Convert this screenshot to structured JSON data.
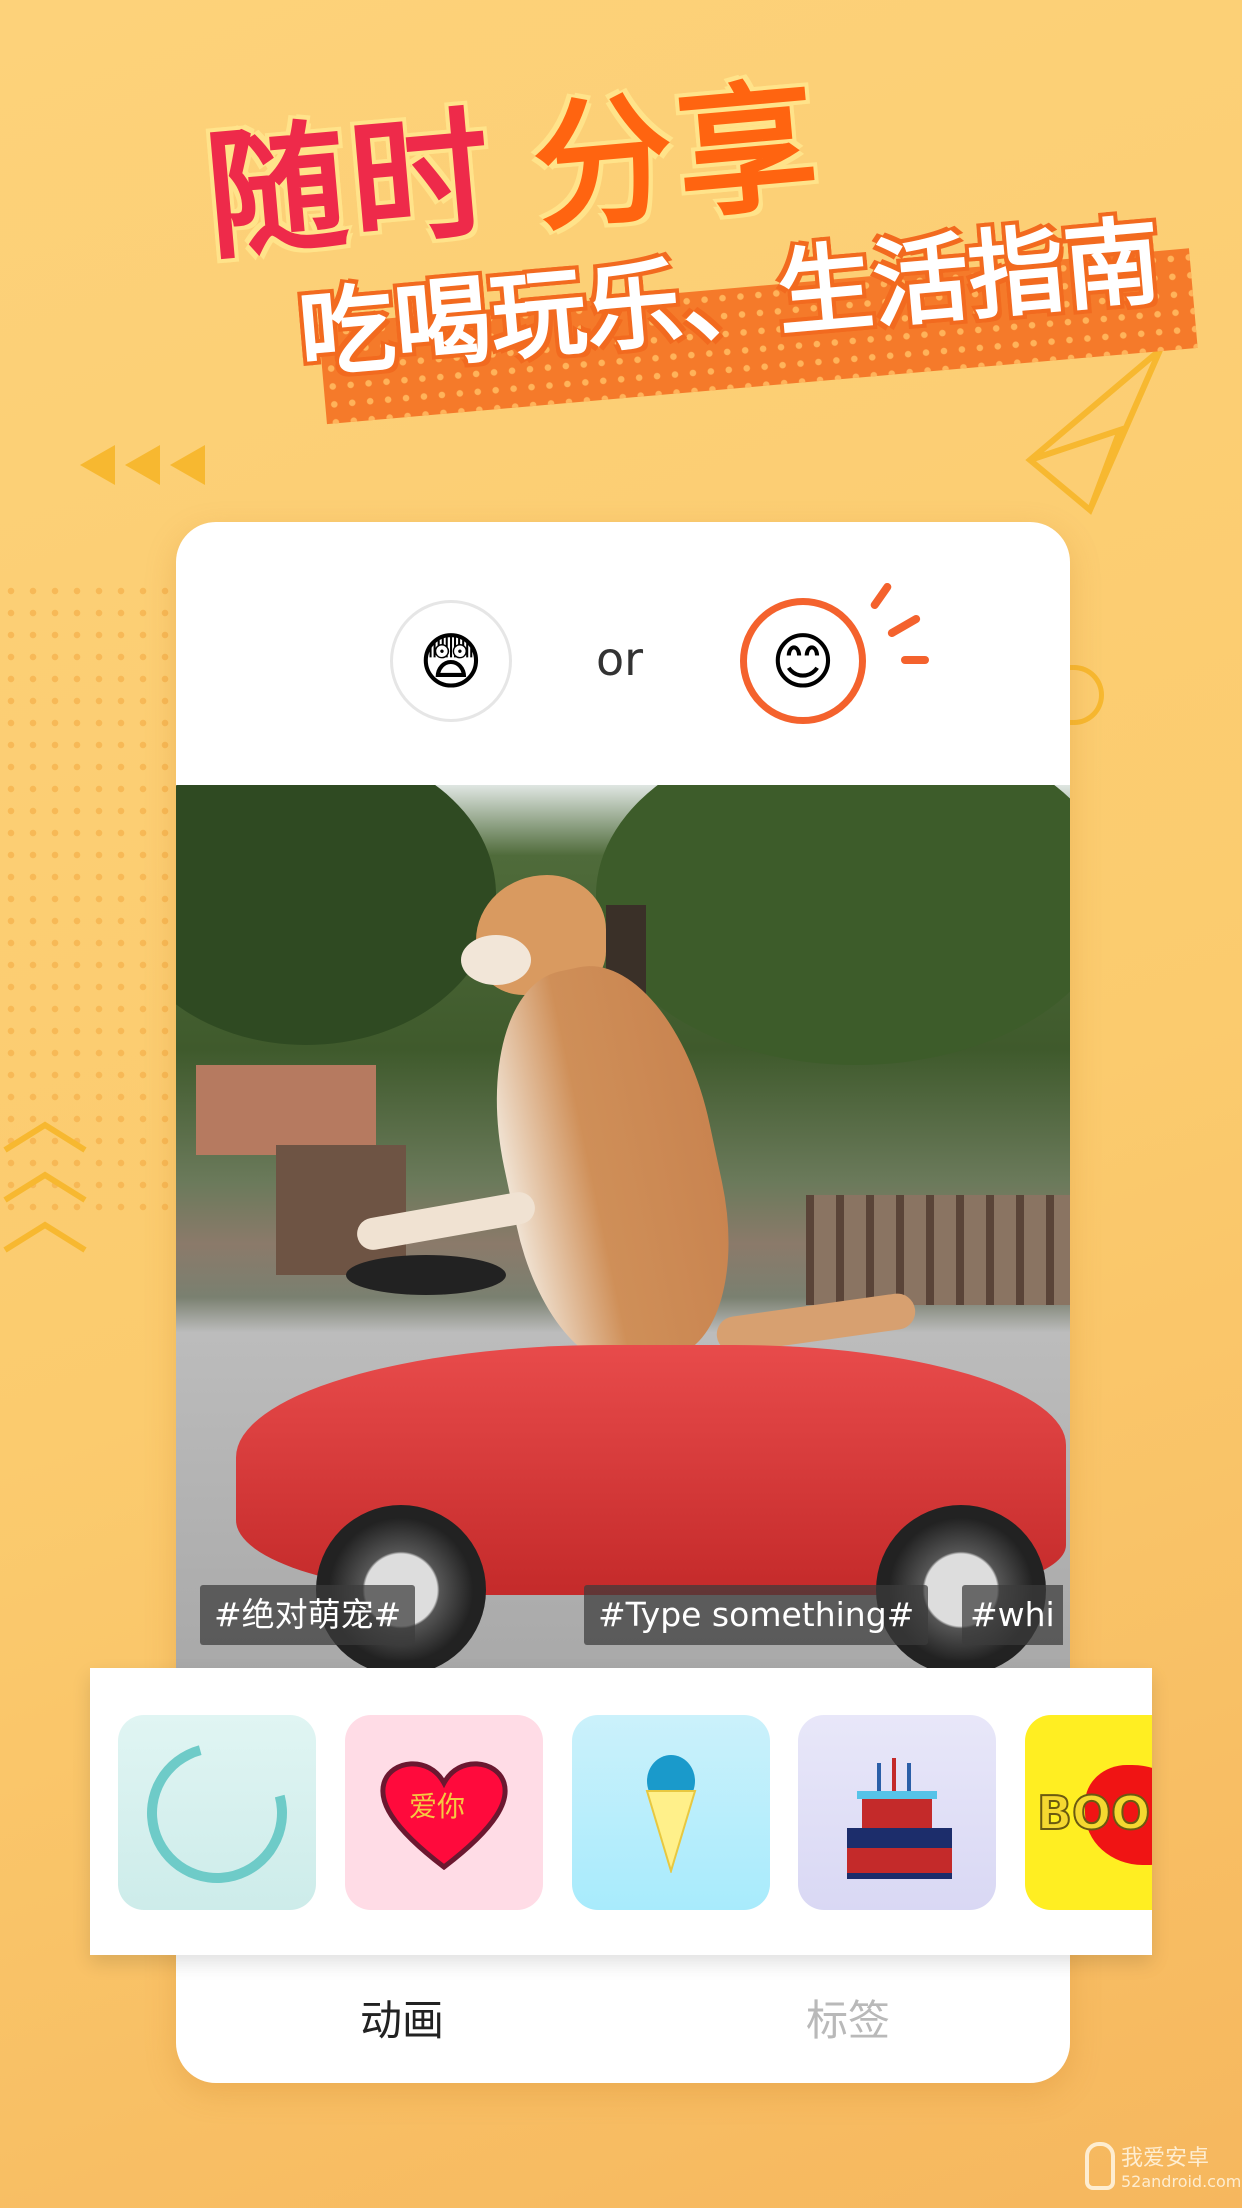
{
  "headline": {
    "line1_part1": "随时",
    "line1_part2": "分享",
    "line2": "吃喝玩乐、生活指南"
  },
  "card": {
    "reaction_left": {
      "emoji": "😨",
      "icon": "fearful-face-icon"
    },
    "or_label": "or",
    "reaction_right": {
      "emoji": "😊",
      "icon": "smiling-face-icon",
      "selected": true
    },
    "tags": [
      "#绝对萌宠#",
      "#Type something#",
      "#whi"
    ],
    "stickers": [
      {
        "name": "water-ring",
        "bg": "#d9f2f1"
      },
      {
        "name": "heart",
        "text": "爱你",
        "bg": "#ffdce6"
      },
      {
        "name": "ice-cream",
        "bg": "#c7f0fb"
      },
      {
        "name": "birthday-cake",
        "bg": "#e3e2f7"
      },
      {
        "name": "boom",
        "text": "BOO",
        "bg": "#ffee22"
      }
    ],
    "tabs": [
      {
        "label": "动画",
        "active": true
      },
      {
        "label": "标签",
        "active": false
      }
    ]
  },
  "watermark": {
    "name": "我爱安卓",
    "url": "52android.com"
  },
  "colors": {
    "accent": "#f4622d",
    "background": "#fbcb6e",
    "title_red": "#ee2a4a",
    "title_orange": "#ff6410"
  }
}
